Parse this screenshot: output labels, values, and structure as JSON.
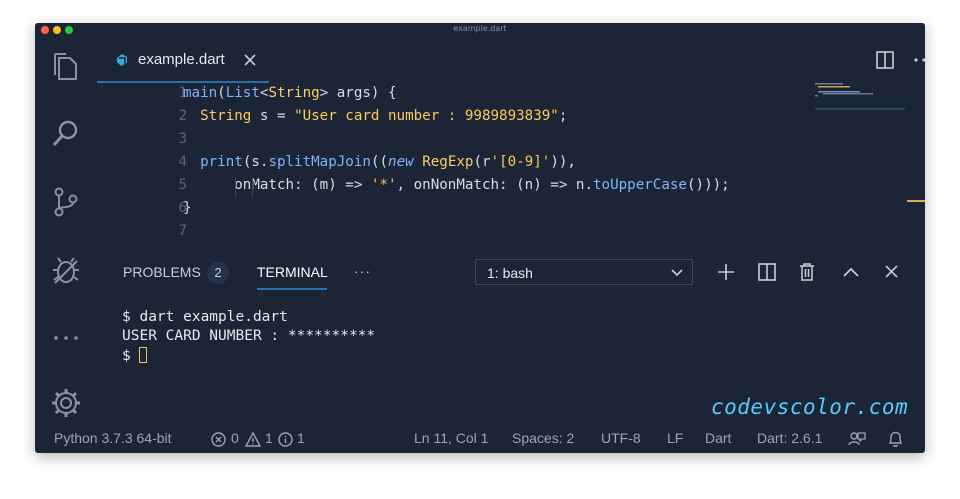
{
  "window": {
    "title": "example.dart"
  },
  "tab": {
    "label": "example.dart"
  },
  "editor": {
    "line_numbers": [
      "1",
      "2",
      "3",
      "4",
      "5",
      "6",
      "7"
    ]
  },
  "panel": {
    "problems_label": "PROBLEMS",
    "problems_count": "2",
    "terminal_label": "TERMINAL",
    "more_label": "···",
    "shell_select": "1: bash"
  },
  "terminal": {
    "lines": [
      "$ dart example.dart",
      "USER CARD NUMBER : **********",
      "$ "
    ]
  },
  "watermark": "codevscolor.com",
  "status": {
    "python": "Python 3.7.3 64-bit",
    "errors": "0",
    "warnings": "1",
    "infos": "1",
    "position": "Ln 11, Col 1",
    "spaces": "Spaces: 2",
    "encoding": "UTF-8",
    "eol": "LF",
    "language": "Dart",
    "sdk": "Dart: 2.6.1"
  },
  "colors": {
    "background": "#1b2535",
    "accent": "#2e6fa8",
    "cursor": "#f2c94c",
    "watermark": "#59c9ff"
  }
}
